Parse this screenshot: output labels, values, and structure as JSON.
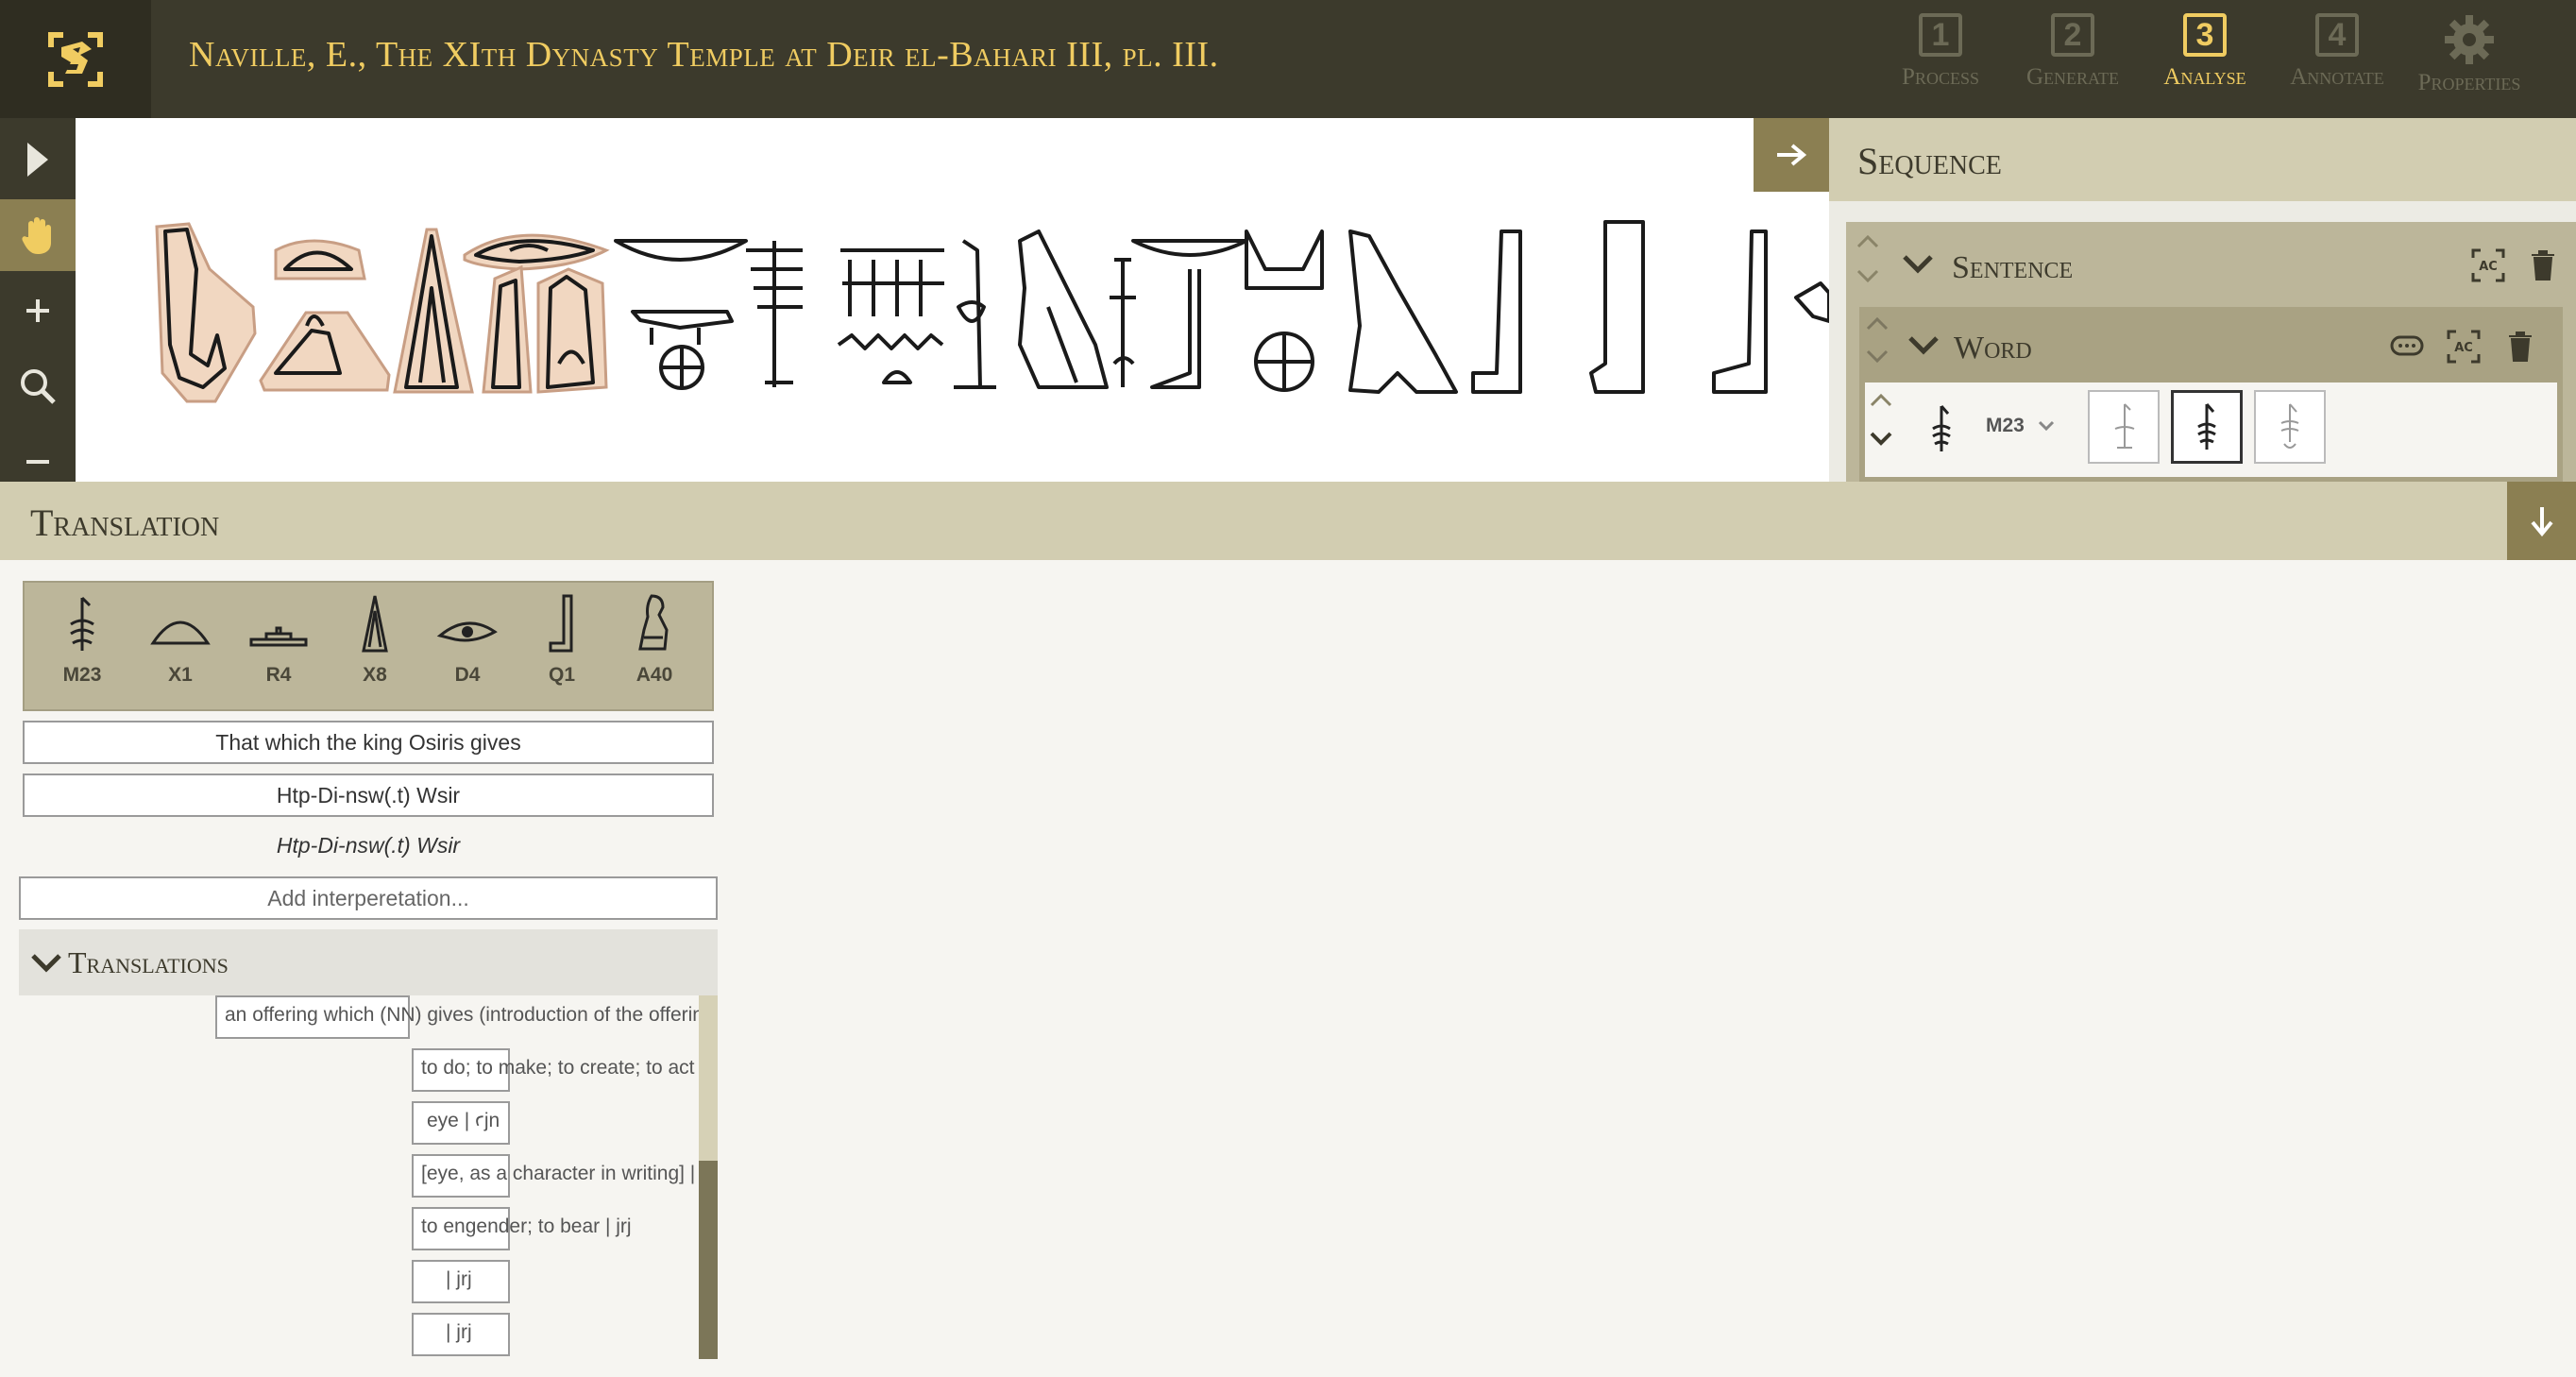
{
  "app": {
    "document_title": "Naville, E., The XIth Dynasty Temple at Deir el-Bahari III, pl. III.",
    "accent": "#f0cc61"
  },
  "steps": [
    {
      "num": "1",
      "label": "Process",
      "active": false
    },
    {
      "num": "2",
      "label": "Generate",
      "active": false
    },
    {
      "num": "3",
      "label": "Analyse",
      "active": true
    },
    {
      "num": "4",
      "label": "Annotate",
      "active": false
    },
    {
      "label": "Properties",
      "icon": "gear-icon",
      "active": false
    }
  ],
  "tools": [
    "select-pointer-icon",
    "pan-hand-icon",
    "zoom-in-icon",
    "search-icon",
    "zoom-out-icon"
  ],
  "sequence": {
    "title": "Sequence",
    "sentence_label": "Sentence",
    "word_label": "Word",
    "selected_sign": "M23"
  },
  "translation": {
    "title": "Translation",
    "signs": [
      "M23",
      "X1",
      "R4",
      "X8",
      "D4",
      "Q1",
      "A40"
    ],
    "meaning": "That which the king Osiris gives",
    "transliteration": "Htp-Di-nsw(.t) Wsir",
    "transliteration_display": "Htp-Di-nsw(.t) Wsir",
    "interpretation_placeholder": "Add interperetation...",
    "translations_label": "Translations",
    "entries": [
      "an offering which (NN) gives (introduction of the offering formula)",
      "to do; to make; to create; to act as",
      "eye | ꜥjn",
      "[eye, as a character in writing] | jrt",
      "to engender; to bear | jrj",
      "| jrj",
      "| jrj"
    ]
  }
}
